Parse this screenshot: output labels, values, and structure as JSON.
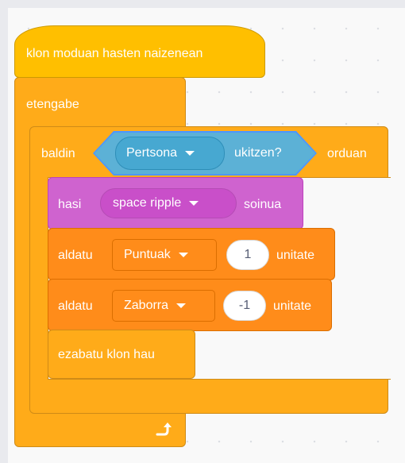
{
  "workspace": {
    "hat_block": {
      "label": "klon moduan hasten naizenean"
    },
    "forever_block": {
      "label": "etengabe",
      "loop_icon": "loop-arrow-icon"
    },
    "if_block": {
      "label_start": "baldin",
      "label_end": "orduan",
      "condition": {
        "menu_value": "Pertsona",
        "label": "ukitzen?"
      }
    },
    "sound_block": {
      "label_start": "hasi",
      "menu_value": "space ripple",
      "label_end": "soinua"
    },
    "change_block_1": {
      "label_start": "aldatu",
      "variable": "Puntuak",
      "value": "1",
      "label_end": "unitate"
    },
    "change_block_2": {
      "label_start": "aldatu",
      "variable": "Zaborra",
      "value": "-1",
      "label_end": "unitate"
    },
    "delete_clone_block": {
      "label": "ezabatu klon hau"
    }
  },
  "colors": {
    "events": "#ffbf00",
    "control": "#ffab19",
    "sensing": "#5cb1d6",
    "sound": "#cf63cf",
    "variables": "#ff8c1a"
  }
}
